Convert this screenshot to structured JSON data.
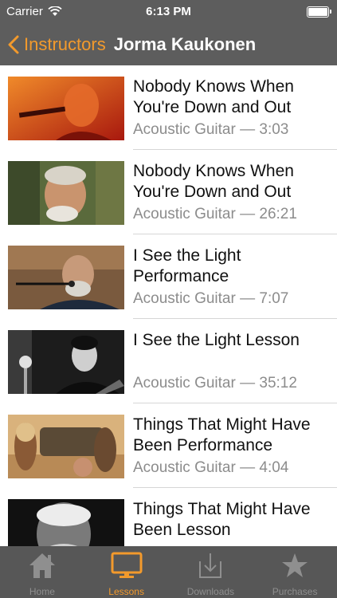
{
  "status": {
    "carrier": "Carrier",
    "time": "6:13 PM"
  },
  "nav": {
    "back_label": "Instructors",
    "title": "Jorma Kaukonen"
  },
  "lessons": [
    {
      "title": "Nobody Knows When You're Down and Out",
      "meta": "Acoustic Guitar — 3:03"
    },
    {
      "title": "Nobody Knows When You're Down and Out",
      "meta": "Acoustic Guitar — 26:21"
    },
    {
      "title": "I See the Light Performance",
      "meta": "Acoustic Guitar — 7:07"
    },
    {
      "title": "I See the Light Lesson",
      "meta": "Acoustic Guitar — 35:12"
    },
    {
      "title": "Things That Might Have Been Performance",
      "meta": "Acoustic Guitar — 4:04"
    },
    {
      "title": "Things That Might Have Been Lesson",
      "meta": ""
    }
  ],
  "tabs": [
    {
      "label": "Home",
      "icon": "home-icon"
    },
    {
      "label": "Lessons",
      "icon": "monitor-icon"
    },
    {
      "label": "Downloads",
      "icon": "download-icon"
    },
    {
      "label": "Purchases",
      "icon": "star-icon"
    }
  ],
  "colors": {
    "accent": "#f39a2c",
    "bar": "#5d5d5d",
    "tabbar": "#575757",
    "secondary_text": "#8c8c8c"
  }
}
